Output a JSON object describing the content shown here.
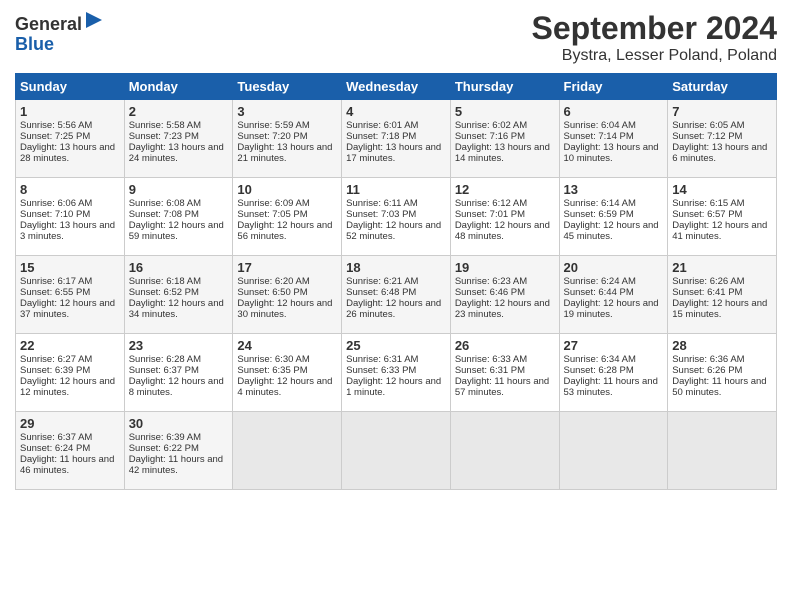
{
  "header": {
    "logo_line1": "General",
    "logo_line2": "Blue",
    "month": "September 2024",
    "location": "Bystra, Lesser Poland, Poland"
  },
  "days_of_week": [
    "Sunday",
    "Monday",
    "Tuesday",
    "Wednesday",
    "Thursday",
    "Friday",
    "Saturday"
  ],
  "weeks": [
    [
      {
        "day": "1",
        "sunrise": "5:56 AM",
        "sunset": "7:25 PM",
        "daylight": "13 hours and 28 minutes."
      },
      {
        "day": "2",
        "sunrise": "5:58 AM",
        "sunset": "7:23 PM",
        "daylight": "13 hours and 24 minutes."
      },
      {
        "day": "3",
        "sunrise": "5:59 AM",
        "sunset": "7:20 PM",
        "daylight": "13 hours and 21 minutes."
      },
      {
        "day": "4",
        "sunrise": "6:01 AM",
        "sunset": "7:18 PM",
        "daylight": "13 hours and 17 minutes."
      },
      {
        "day": "5",
        "sunrise": "6:02 AM",
        "sunset": "7:16 PM",
        "daylight": "13 hours and 14 minutes."
      },
      {
        "day": "6",
        "sunrise": "6:04 AM",
        "sunset": "7:14 PM",
        "daylight": "13 hours and 10 minutes."
      },
      {
        "day": "7",
        "sunrise": "6:05 AM",
        "sunset": "7:12 PM",
        "daylight": "13 hours and 6 minutes."
      }
    ],
    [
      {
        "day": "8",
        "sunrise": "6:06 AM",
        "sunset": "7:10 PM",
        "daylight": "13 hours and 3 minutes."
      },
      {
        "day": "9",
        "sunrise": "6:08 AM",
        "sunset": "7:08 PM",
        "daylight": "12 hours and 59 minutes."
      },
      {
        "day": "10",
        "sunrise": "6:09 AM",
        "sunset": "7:05 PM",
        "daylight": "12 hours and 56 minutes."
      },
      {
        "day": "11",
        "sunrise": "6:11 AM",
        "sunset": "7:03 PM",
        "daylight": "12 hours and 52 minutes."
      },
      {
        "day": "12",
        "sunrise": "6:12 AM",
        "sunset": "7:01 PM",
        "daylight": "12 hours and 48 minutes."
      },
      {
        "day": "13",
        "sunrise": "6:14 AM",
        "sunset": "6:59 PM",
        "daylight": "12 hours and 45 minutes."
      },
      {
        "day": "14",
        "sunrise": "6:15 AM",
        "sunset": "6:57 PM",
        "daylight": "12 hours and 41 minutes."
      }
    ],
    [
      {
        "day": "15",
        "sunrise": "6:17 AM",
        "sunset": "6:55 PM",
        "daylight": "12 hours and 37 minutes."
      },
      {
        "day": "16",
        "sunrise": "6:18 AM",
        "sunset": "6:52 PM",
        "daylight": "12 hours and 34 minutes."
      },
      {
        "day": "17",
        "sunrise": "6:20 AM",
        "sunset": "6:50 PM",
        "daylight": "12 hours and 30 minutes."
      },
      {
        "day": "18",
        "sunrise": "6:21 AM",
        "sunset": "6:48 PM",
        "daylight": "12 hours and 26 minutes."
      },
      {
        "day": "19",
        "sunrise": "6:23 AM",
        "sunset": "6:46 PM",
        "daylight": "12 hours and 23 minutes."
      },
      {
        "day": "20",
        "sunrise": "6:24 AM",
        "sunset": "6:44 PM",
        "daylight": "12 hours and 19 minutes."
      },
      {
        "day": "21",
        "sunrise": "6:26 AM",
        "sunset": "6:41 PM",
        "daylight": "12 hours and 15 minutes."
      }
    ],
    [
      {
        "day": "22",
        "sunrise": "6:27 AM",
        "sunset": "6:39 PM",
        "daylight": "12 hours and 12 minutes."
      },
      {
        "day": "23",
        "sunrise": "6:28 AM",
        "sunset": "6:37 PM",
        "daylight": "12 hours and 8 minutes."
      },
      {
        "day": "24",
        "sunrise": "6:30 AM",
        "sunset": "6:35 PM",
        "daylight": "12 hours and 4 minutes."
      },
      {
        "day": "25",
        "sunrise": "6:31 AM",
        "sunset": "6:33 PM",
        "daylight": "12 hours and 1 minute."
      },
      {
        "day": "26",
        "sunrise": "6:33 AM",
        "sunset": "6:31 PM",
        "daylight": "11 hours and 57 minutes."
      },
      {
        "day": "27",
        "sunrise": "6:34 AM",
        "sunset": "6:28 PM",
        "daylight": "11 hours and 53 minutes."
      },
      {
        "day": "28",
        "sunrise": "6:36 AM",
        "sunset": "6:26 PM",
        "daylight": "11 hours and 50 minutes."
      }
    ],
    [
      {
        "day": "29",
        "sunrise": "6:37 AM",
        "sunset": "6:24 PM",
        "daylight": "11 hours and 46 minutes."
      },
      {
        "day": "30",
        "sunrise": "6:39 AM",
        "sunset": "6:22 PM",
        "daylight": "11 hours and 42 minutes."
      },
      null,
      null,
      null,
      null,
      null
    ]
  ]
}
